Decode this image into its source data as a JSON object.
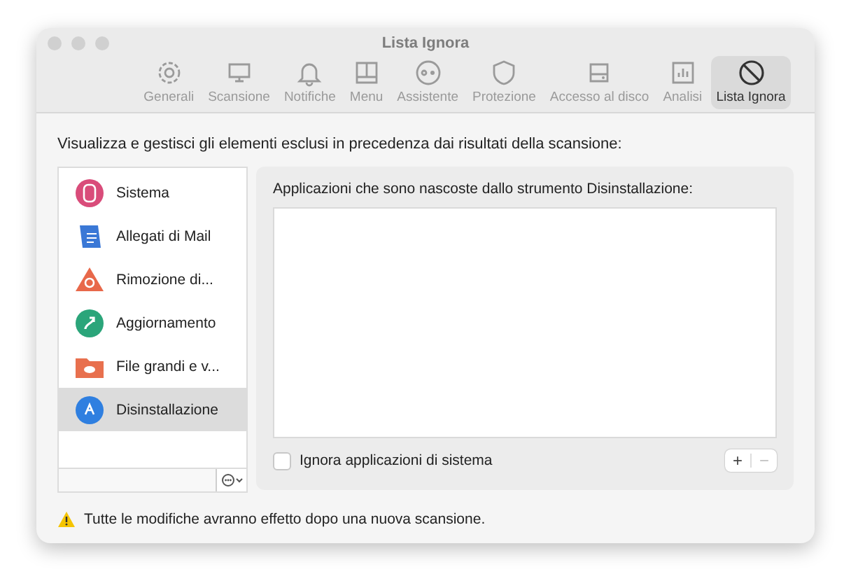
{
  "window": {
    "title": "Lista Ignora"
  },
  "toolbar": [
    {
      "label": "Generali",
      "selected": false
    },
    {
      "label": "Scansione",
      "selected": false
    },
    {
      "label": "Notifiche",
      "selected": false
    },
    {
      "label": "Menu",
      "selected": false
    },
    {
      "label": "Assistente",
      "selected": false
    },
    {
      "label": "Protezione",
      "selected": false
    },
    {
      "label": "Accesso al disco",
      "selected": false
    },
    {
      "label": "Analisi",
      "selected": false
    },
    {
      "label": "Lista Ignora",
      "selected": true
    }
  ],
  "description": "Visualizza e gestisci gli elementi esclusi in precedenza dai risultati della scansione:",
  "sidebar": {
    "items": [
      {
        "label": "Sistema",
        "selected": false
      },
      {
        "label": "Allegati di Mail",
        "selected": false
      },
      {
        "label": "Rimozione di...",
        "selected": false
      },
      {
        "label": "Aggiornamento",
        "selected": false
      },
      {
        "label": "File grandi e v...",
        "selected": false
      },
      {
        "label": "Disinstallazione",
        "selected": true
      }
    ]
  },
  "panel": {
    "heading": "Applicazioni che sono nascoste dallo strumento Disinstallazione:",
    "checkbox": {
      "label": "Ignora applicazioni di sistema",
      "checked": false
    },
    "add": {
      "label": "+",
      "disabled": false
    },
    "remove": {
      "label": "−",
      "disabled": true
    }
  },
  "footer": {
    "warning": "Tutte le modifiche avranno effetto dopo una nuova scansione."
  }
}
